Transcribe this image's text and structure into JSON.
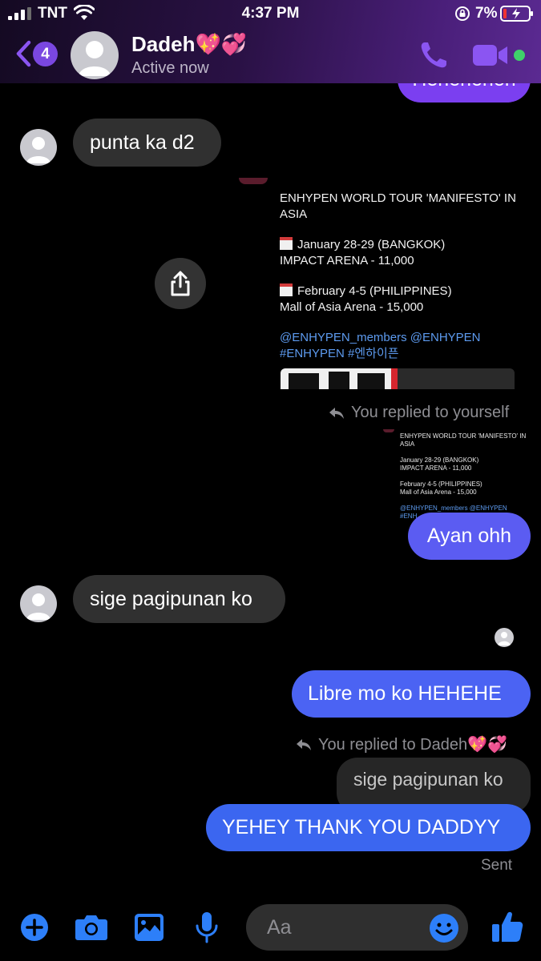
{
  "status_bar": {
    "carrier": "TNT",
    "time": "4:37 PM",
    "battery": "7%"
  },
  "header": {
    "back_badge": "4",
    "contact_name": "Dadeh💖💞",
    "contact_status": "Active now"
  },
  "messages": {
    "top_partial": "Heheheheh",
    "m1": "punta ka d2",
    "shared_post": {
      "title_line1": "ENHYPEN WORLD TOUR 'MANIFESTO' IN",
      "title_line2": "ASIA",
      "date1": "January 28-29 (BANGKOK)",
      "venue1": "IMPACT ARENA - 11,000",
      "date2": "February 4-5 (PHILIPPINES)",
      "venue2": "Mall of Asia Arena - 15,000",
      "links1": "@ENHYPEN_members @ENHYPEN",
      "links2": "#ENHYPEN #엔하이픈"
    },
    "reply_note1": "You replied to yourself",
    "mini_post": {
      "title_line1": "ENHYPEN WORLD TOUR 'MANIFESTO' IN",
      "title_line2": "ASIA",
      "date1": "January 28-29 (BANGKOK)",
      "venue1": "IMPACT ARENA - 11,000",
      "date2": "February 4-5 (PHILIPPINES)",
      "venue2": "Mall of Asia Arena - 15,000",
      "links1": "@ENHYPEN_members @ENHYPEN",
      "links2": "#ENH"
    },
    "m2": "Ayan ohh",
    "m3": "sige pagipunan ko",
    "m4": "Libre mo ko HEHEHE",
    "reply_note2": "You replied to Dadeh💖💞",
    "quoted": "sige pagipunan ko",
    "m5": "YEHEY THANK YOU DADDYY",
    "sent_label": "Sent"
  },
  "composer": {
    "placeholder": "Aa"
  },
  "colors": {
    "accent": "#7a47e0",
    "bubble_purple": "#6f4ef2",
    "bubble_blue": "#3b66f0",
    "incoming": "#303030",
    "icons_blue": "#2d7ff9"
  },
  "icons": [
    "signal-icon",
    "wifi-icon",
    "rotation-lock-icon",
    "battery-icon",
    "back-chevron-icon",
    "phone-icon",
    "video-icon",
    "share-icon",
    "reply-arrow-icon",
    "plus-icon",
    "camera-icon",
    "image-icon",
    "microphone-icon",
    "emoji-icon",
    "thumbs-up-icon"
  ]
}
